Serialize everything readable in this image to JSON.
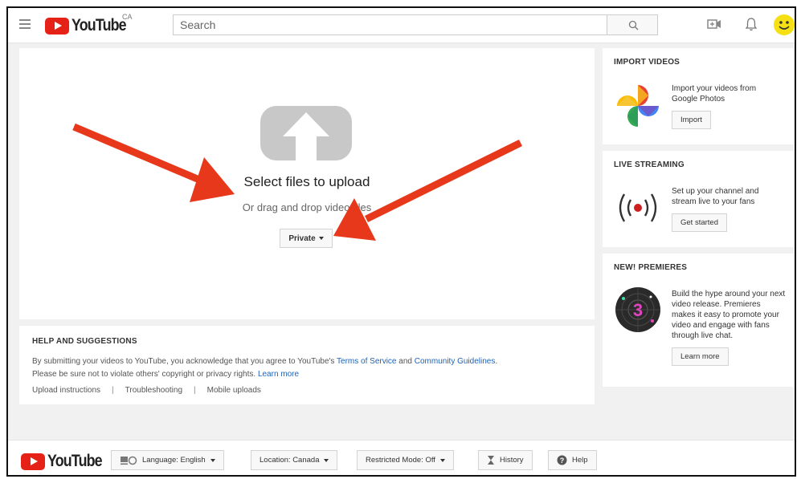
{
  "header": {
    "logo_text": "YouTube",
    "region": "CA",
    "search_placeholder": "Search"
  },
  "upload": {
    "title": "Select files to upload",
    "subtitle": "Or drag and drop video files",
    "privacy_label": "Private"
  },
  "help": {
    "heading": "HELP AND SUGGESTIONS",
    "text_before": "By submitting your videos to YouTube, you acknowledge that you agree to YouTube's ",
    "terms_link": "Terms of Service",
    "text_and": " and ",
    "guidelines_link": "Community Guidelines",
    "text_end": ".",
    "text_line2": "Please be sure not to violate others' copyright or privacy rights. ",
    "learn_more": "Learn more",
    "links": [
      "Upload instructions",
      "Troubleshooting",
      "Mobile uploads"
    ]
  },
  "sidebar": {
    "import": {
      "heading": "IMPORT VIDEOS",
      "body": "Import your videos from Google Photos",
      "button": "Import"
    },
    "live": {
      "heading": "LIVE STREAMING",
      "body": "Set up your channel and stream live to your fans",
      "button": "Get started"
    },
    "premieres": {
      "heading": "NEW! PREMIERES",
      "body": "Build the hype around your next video release. Premieres makes it easy to promote your video and engage with fans through live chat.",
      "button": "Learn more",
      "badge_number": "3"
    }
  },
  "footer": {
    "logo_text": "YouTube",
    "language": "Language: English",
    "location": "Location: Canada",
    "restricted": "Restricted Mode: Off",
    "history": "History",
    "help": "Help"
  },
  "colors": {
    "brand_red": "#e62117",
    "link_blue": "#1c62b9",
    "arrow_red": "#e8381c",
    "background": "#f1f1f1"
  },
  "icons": [
    "menu-icon",
    "youtube-logo-icon",
    "search-icon",
    "video-camera-icon",
    "bell-icon",
    "avatar-smiley-icon",
    "upload-arrow-icon",
    "google-photos-icon",
    "live-broadcast-icon",
    "premieres-icon",
    "language-icon",
    "hourglass-icon",
    "help-icon"
  ]
}
